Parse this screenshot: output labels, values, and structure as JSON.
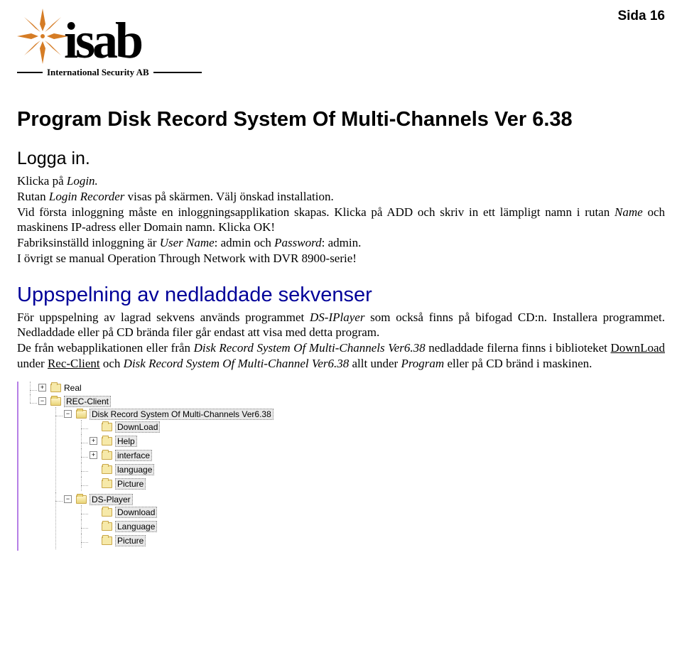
{
  "page_label": "Sida 16",
  "logo": {
    "text": "isab",
    "tagline": "International Security AB",
    "star_color": "#d57c25"
  },
  "h1": "Program Disk Record System Of Multi-Channels Ver 6.38",
  "h2_login": "Logga in.",
  "login": {
    "l1_pre": "Klicka på ",
    "l1_it": "Login.",
    "l2_pre": "Rutan ",
    "l2_it": "Login Recorder",
    "l2_post": " visas på skärmen. Välj önskad installation.",
    "l3_pre": "Vid första inloggning måste en inloggningsapplikation skapas. Klicka på ADD och skriv in ett lämpligt namn i rutan ",
    "l3_it": "Name",
    "l3_post": " och maskinens IP-adress eller Domain namn. Klicka OK!",
    "l4_pre": "Fabriksinställd inloggning är ",
    "l4_it1": "User Name",
    "l4_mid": ": admin och ",
    "l4_it2": "Password",
    "l4_post": ": admin.",
    "l5": "I övrigt se manual Operation Through Network with DVR 8900-serie!"
  },
  "h2_play": "Uppspelning av nedladdade sekvenser",
  "play": {
    "p1_pre": "För uppspelning av lagrad sekvens används programmet ",
    "p1_it": "DS-IPlayer",
    "p1_post": " som också finns på bifogad CD:n. Installera programmet. Nedladdade eller på CD brända filer går endast att visa med detta program.",
    "p2_a": "De från webapplikationen eller från ",
    "p2_b_it": "Disk Record System Of Multi-Channels Ver6.38",
    "p2_c": " nedladdade filerna finns i biblioteket ",
    "p2_d_ul": "DownLoad",
    "p2_e": " under ",
    "p2_f_ul": "Rec-Client",
    "p2_g": " och ",
    "p2_h_it": "Disk Record System Of Multi-Channel Ver6.38",
    "p2_i": " allt under ",
    "p2_j_it": "Program",
    "p2_k": " eller på CD bränd i maskinen."
  },
  "tree": {
    "items": [
      {
        "exp": "plus",
        "folder": "closed",
        "label": "Real",
        "sel": false
      },
      {
        "exp": "minus",
        "folder": "open",
        "label": "REC-Client",
        "sel": true,
        "children": [
          {
            "exp": "minus",
            "folder": "open",
            "label": "Disk Record System Of Multi-Channels Ver6.38",
            "children": [
              {
                "exp": "none",
                "folder": "closed",
                "label": "DownLoad"
              },
              {
                "exp": "plus",
                "folder": "closed",
                "label": "Help"
              },
              {
                "exp": "plus",
                "folder": "closed",
                "label": "interface"
              },
              {
                "exp": "none",
                "folder": "closed",
                "label": "language"
              },
              {
                "exp": "none",
                "folder": "closed",
                "label": "Picture"
              }
            ]
          },
          {
            "exp": "minus",
            "folder": "open",
            "label": "DS-Player",
            "children": [
              {
                "exp": "none",
                "folder": "closed",
                "label": "Download"
              },
              {
                "exp": "none",
                "folder": "closed",
                "label": "Language"
              },
              {
                "exp": "none",
                "folder": "closed",
                "label": "Picture"
              }
            ]
          }
        ]
      }
    ]
  }
}
